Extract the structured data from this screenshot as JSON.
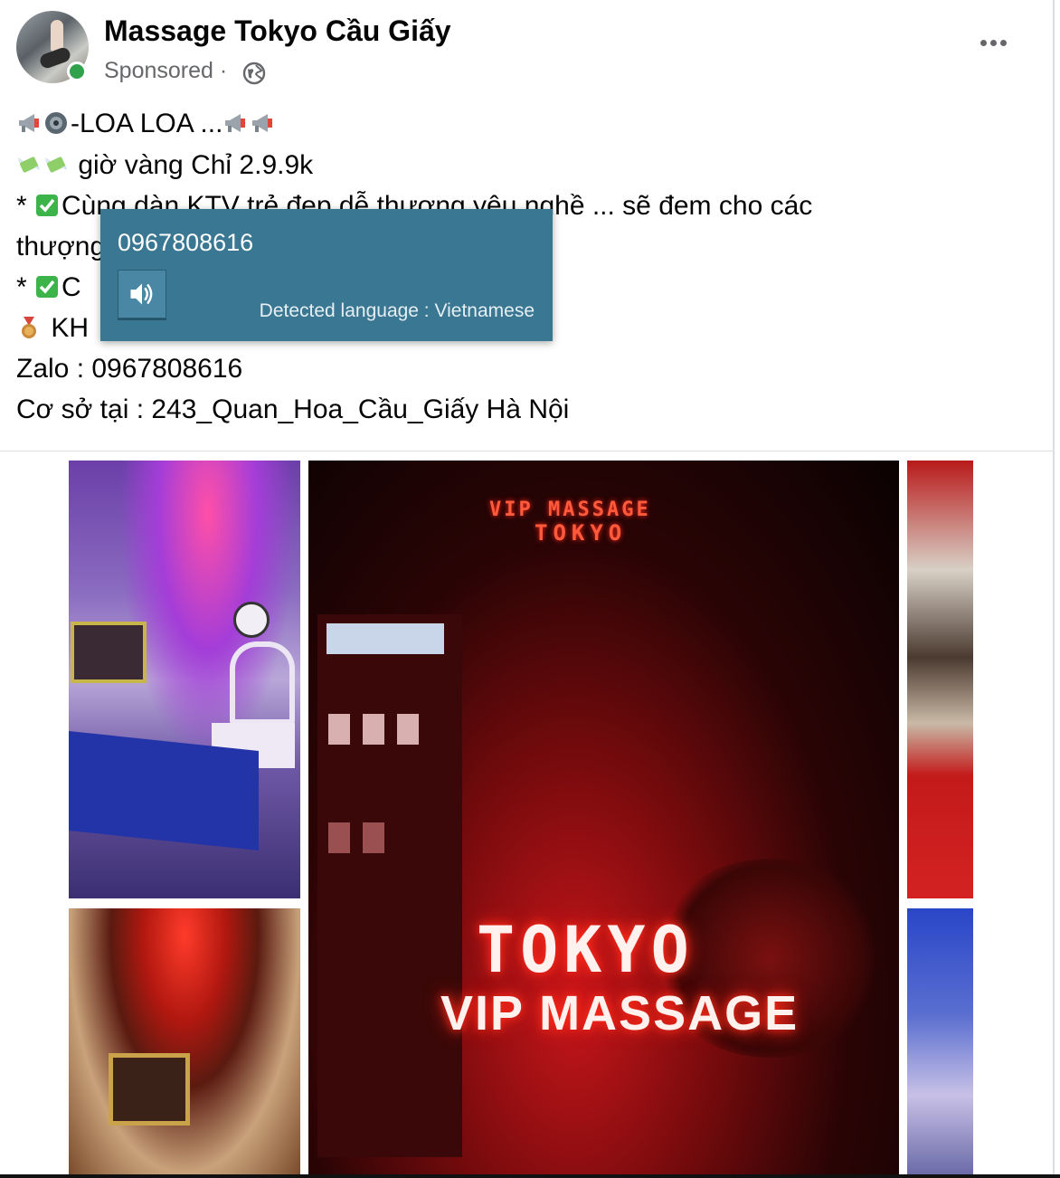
{
  "post": {
    "page_name": "Massage Tokyo Cầu Giấy",
    "sponsored_label": "Sponsored",
    "sponsored_sep": "·",
    "lines": {
      "l1": "-LOA LOA ...",
      "l2": " giờ vàng Chỉ 2.9.9k",
      "l3_prefix": " * ",
      "l3_text": "Cùng  dàn KTV  trẻ đẹp dễ thương yêu nghề ... sẽ đem  cho các",
      "l4": "thượng",
      "l5_prefix": " * ",
      "l5_text": "C",
      "l6": " KH",
      "l7": "Zalo : 0967808616",
      "l8": "Cơ sở tại : 243_Quan_Hoa_Cầu_Giấy Hà Nội"
    }
  },
  "photos": {
    "sign_top_line1": "VIP MASSAGE",
    "sign_top_line2": "TOKYO",
    "sign_main_line1": "TOKYO",
    "sign_main_line2": "VIP MASSAGE"
  },
  "translate_popup": {
    "text": "0967808616",
    "detected_language": "Detected language : Vietnamese",
    "speaker_icon": "speaker-icon"
  },
  "icons": {
    "more": "more-options-icon",
    "globe": "globe-icon",
    "megaphone": "megaphone-icon",
    "speaker": "speaker-emoji-icon",
    "money": "money-wings-icon",
    "check": "check-mark-button-icon",
    "medal": "medal-icon"
  },
  "colors": {
    "popup_bg": "#3a7793",
    "online": "#31a24c",
    "secondary_text": "#65676b",
    "check_green": "#3cb44a"
  }
}
